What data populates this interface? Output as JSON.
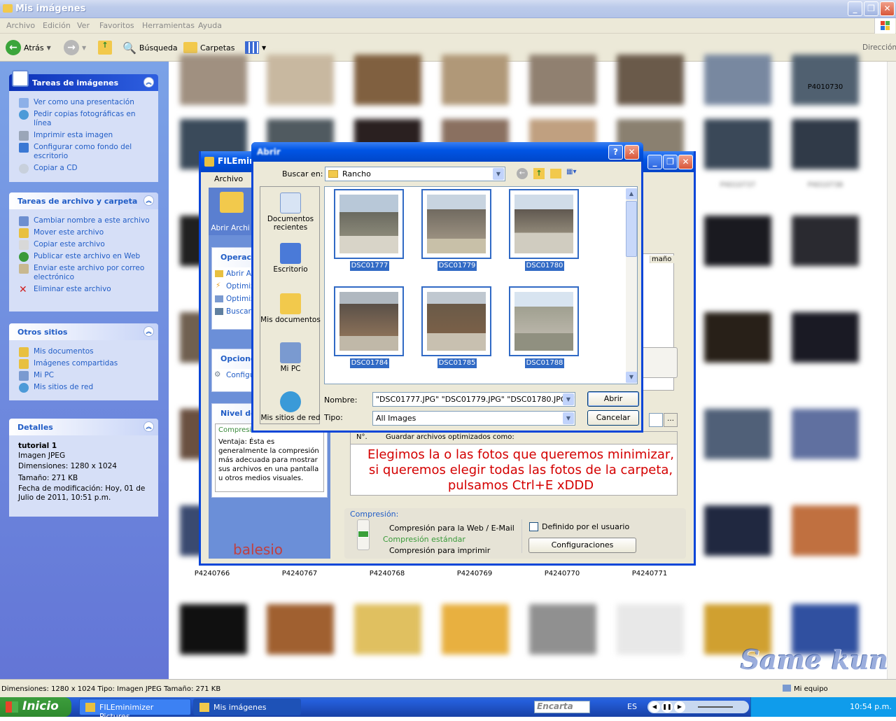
{
  "explorer": {
    "title": "Mis imágenes",
    "menu": [
      "Archivo",
      "Edición",
      "Ver",
      "Favoritos",
      "Herramientas",
      "Ayuda"
    ],
    "toolbar": {
      "back": "Atrás",
      "search": "Búsqueda",
      "folders": "Carpetas",
      "address": "Dirección"
    },
    "image_tasks": {
      "title": "Tareas de imágenes",
      "items": [
        "Ver como una presentación",
        "Pedir copias fotográficas en línea",
        "Imprimir esta imagen",
        "Configurar como fondo del escritorio",
        "Copiar a CD"
      ]
    },
    "file_tasks": {
      "title": "Tareas de archivo y carpeta",
      "items": [
        "Cambiar nombre a este archivo",
        "Mover este archivo",
        "Copiar este archivo",
        "Publicar este archivo en Web",
        "Enviar este archivo por correo electrónico",
        "Eliminar este archivo"
      ]
    },
    "other_places": {
      "title": "Otros sitios",
      "items": [
        "Mis documentos",
        "Imágenes compartidas",
        "Mi PC",
        "Mis sitios de red"
      ]
    },
    "details": {
      "title": "Detalles",
      "name": "tutorial 1",
      "type": "Imagen JPEG",
      "dimensions": "Dimensiones: 1280 x 1024",
      "size": "Tamaño: 271 KB",
      "modified": "Fecha de modificación: Hoy, 01 de Julio de 2011, 10:51 p.m."
    },
    "thumb_labels_top": [
      "P4010730"
    ],
    "thumb_labels_row": [
      "P4240766",
      "P4240767",
      "P4240768",
      "P4240769",
      "P4240770",
      "P4240771"
    ],
    "thumb_labels_right": [
      "P4010737",
      "P4010738"
    ]
  },
  "status": {
    "text": "Dimensiones: 1280 x 1024 Tipo: Imagen JPEG Tamaño: 271 KB",
    "zone": "Mi equipo"
  },
  "filemin": {
    "title": "FILEmin",
    "menu": "Archivo",
    "open_label": "Abrir Archi",
    "ops_title": "Operac",
    "ops": [
      "Abrir Ar",
      "Optimiz",
      "Optimiz",
      "Buscar"
    ],
    "options_title": "Opcione",
    "options_item": "Configu",
    "level_title": "Nivel de",
    "level_selected": "Compresión estándar",
    "level_desc": "Ventaja: Ésta es generalmente la compresión más adecuada para mostrar sus archivos en una pantalla u otros medios visuales.",
    "col_size": "maño",
    "table_header_no": "N°.",
    "table_header_save": "Guardar archivos optimizados como:",
    "annotation": "Elegimos la o las fotos que queremos minimizar, si queremos elegir todas las fotos de la carpeta, pulsamos Ctrl+E xDDD",
    "compression_title": "Compresión:",
    "compression_options": [
      "Compresión para la Web / E-Mail",
      "Compresión estándar",
      "Compresión para imprimir"
    ],
    "custom_label": "Definido por el usuario",
    "config_button": "Configuraciones",
    "brand": "balesio"
  },
  "dialog": {
    "title": "Abrir",
    "look_in_label": "Buscar en:",
    "look_in_value": "Rancho",
    "places": [
      "Documentos recientes",
      "Escritorio",
      "Mis documentos",
      "Mi PC",
      "Mis sitios de red"
    ],
    "files": [
      "DSC01777",
      "DSC01779",
      "DSC01780",
      "DSC01784",
      "DSC01785",
      "DSC01788"
    ],
    "name_label": "Nombre:",
    "name_value": "\"DSC01777.JPG\" \"DSC01779.JPG\" \"DSC01780.JPG\" \"",
    "type_label": "Tipo:",
    "type_value": "All Images",
    "open_button": "Abrir",
    "cancel_button": "Cancelar"
  },
  "taskbar": {
    "start": "Inicio",
    "tasks": [
      "FILEminimizer Pictures",
      "Mis imágenes"
    ],
    "search": "Encarta",
    "lang": "ES",
    "clock": "10:54 p.m."
  },
  "watermark": "Same kun"
}
